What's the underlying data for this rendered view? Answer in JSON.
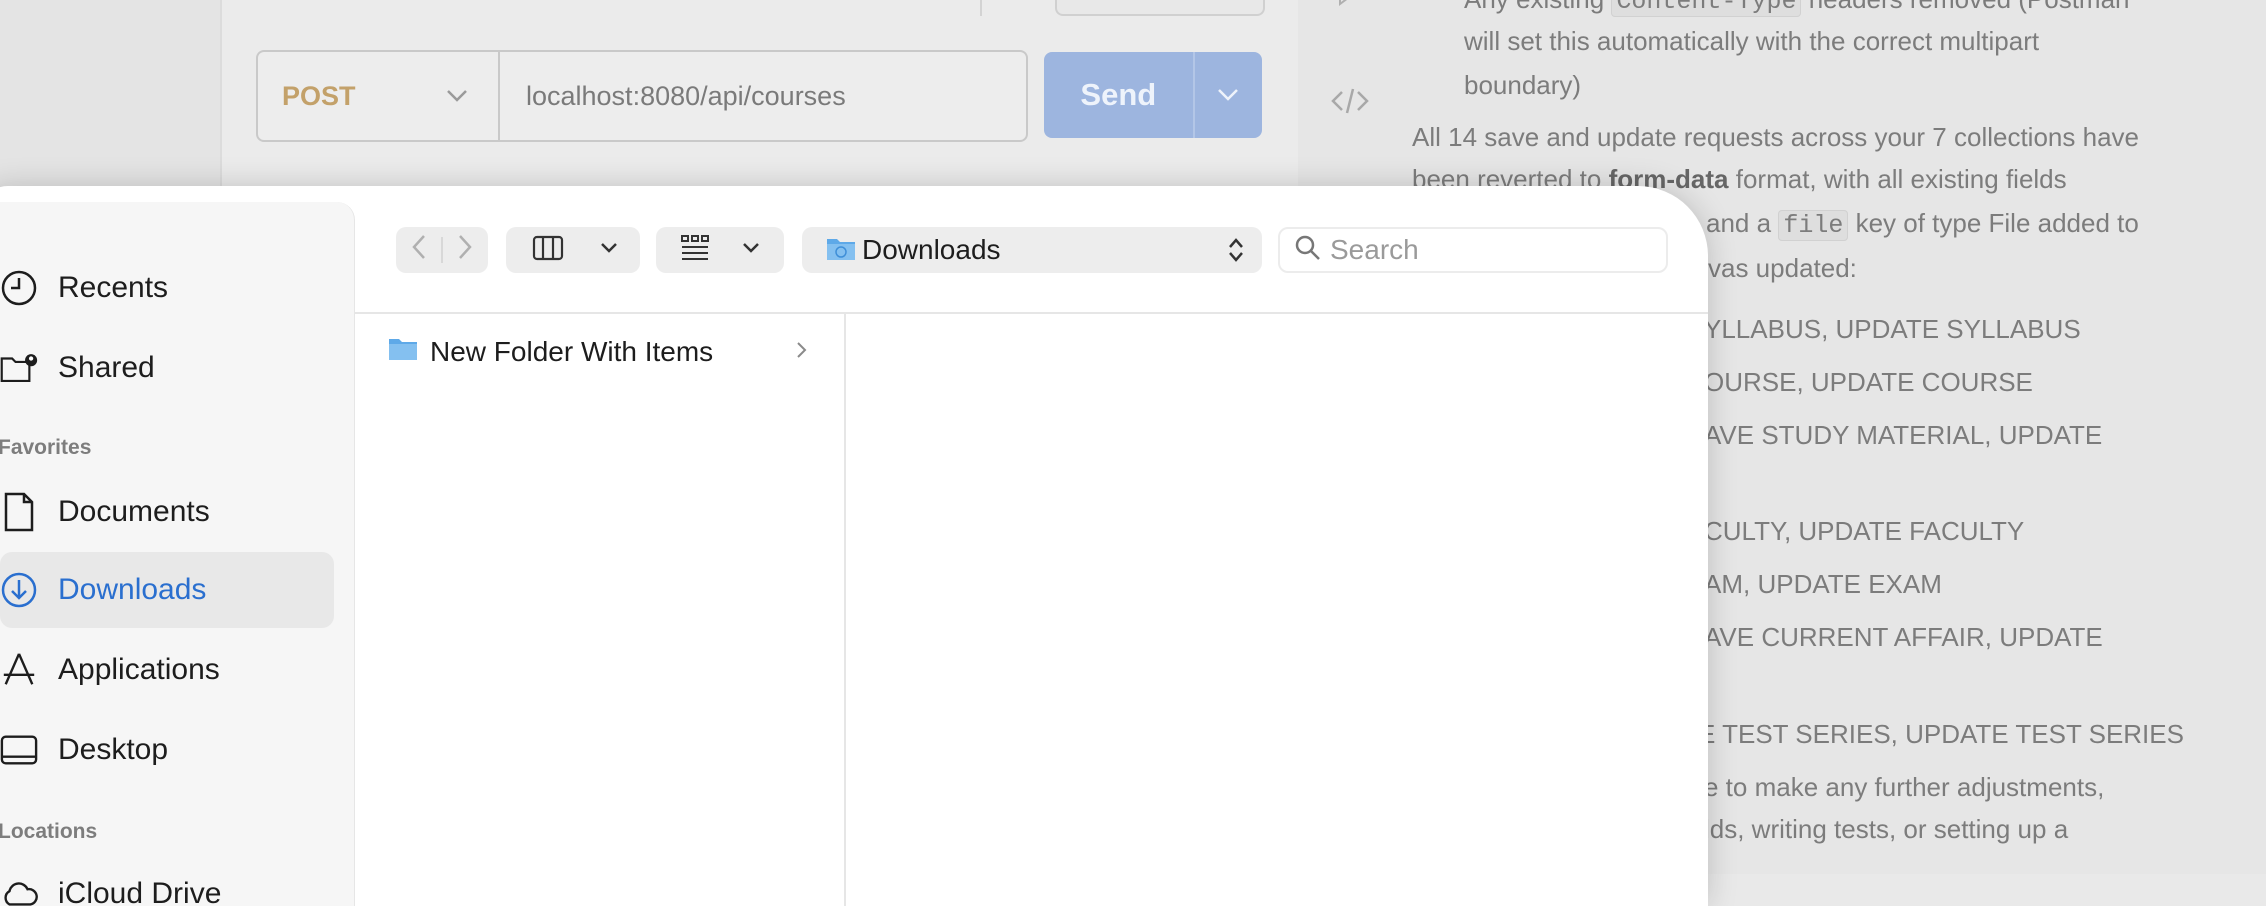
{
  "request": {
    "method": "POST",
    "url": "localhost:8080/api/courses",
    "send_label": "Send"
  },
  "right_panel": {
    "line1": "Any existing",
    "line1_code": "Content-Type",
    "line1_rest": "headers removed (Postman",
    "line2": "will set this automatically with the correct multipart",
    "line3": "boundary)",
    "para1": "All 14 save and update requests across your 7 collections have",
    "para2a": "been reverted to",
    "para2b": "form-data",
    "para2c": "format, with all existing fields",
    "para3a": "and a",
    "para3code": "file",
    "para3b": "key of type File added to",
    "para4": "vas updated:",
    "list": [
      "YLLABUS, UPDATE SYLLABUS",
      "OURSE, UPDATE COURSE",
      "AVE STUDY MATERIAL, UPDATE",
      "CULTY, UPDATE FACULTY",
      "AM, UPDATE EXAM",
      "AVE CURRENT AFFAIR, UPDATE",
      "E TEST SERIES, UPDATE TEST SERIES"
    ],
    "closing1": "e to make any further adjustments,",
    "closing2": "lds, writing tests, or setting up a"
  },
  "dialog": {
    "sidebar": {
      "recents": "Recents",
      "shared": "Shared",
      "favorites_header": "Favorites",
      "documents": "Documents",
      "downloads": "Downloads",
      "applications": "Applications",
      "desktop": "Desktop",
      "locations_header": "Locations",
      "icloud": "iCloud Drive"
    },
    "path": "Downloads",
    "search_placeholder": "Search",
    "items": [
      {
        "name": "New Folder With Items"
      }
    ]
  },
  "colors": {
    "accent": "#2a6fcf",
    "send_button": "#9db5df",
    "method": "#c3a16a"
  }
}
